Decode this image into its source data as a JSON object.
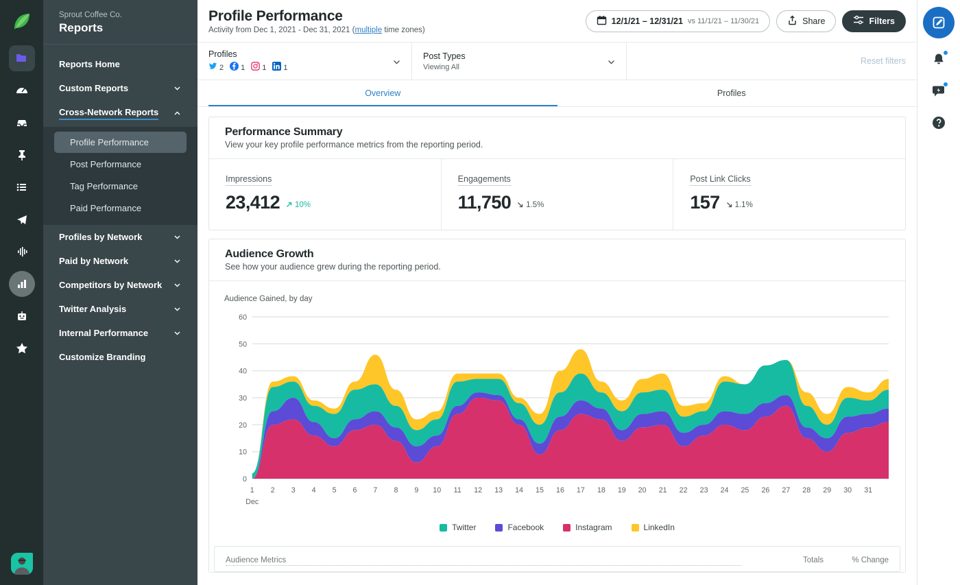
{
  "rail": {
    "logo_icon": "sprout-leaf-logo",
    "items": [
      {
        "name": "folder-icon",
        "state": "boxed"
      },
      {
        "name": "dashboard-gauge-icon",
        "state": "plain"
      },
      {
        "name": "inbox-icon",
        "state": "plain"
      },
      {
        "name": "pin-icon",
        "state": "plain"
      },
      {
        "name": "list-icon",
        "state": "plain"
      },
      {
        "name": "send-paper-plane-icon",
        "state": "plain"
      },
      {
        "name": "audio-waveform-icon",
        "state": "plain"
      },
      {
        "name": "bar-chart-icon",
        "state": "circled"
      },
      {
        "name": "bot-icon",
        "state": "plain"
      },
      {
        "name": "star-icon",
        "state": "plain"
      }
    ],
    "avatar_name": "user-avatar"
  },
  "sidebar": {
    "org": "Sprout Coffee Co.",
    "title": "Reports",
    "items": [
      {
        "label": "Reports Home",
        "chevron": "none"
      },
      {
        "label": "Custom Reports",
        "chevron": "down"
      },
      {
        "label": "Cross-Network Reports",
        "chevron": "up"
      }
    ],
    "sub_items": [
      {
        "label": "Profile Performance",
        "active": true
      },
      {
        "label": "Post Performance",
        "active": false
      },
      {
        "label": "Tag Performance",
        "active": false
      },
      {
        "label": "Paid Performance",
        "active": false
      }
    ],
    "items_bottom": [
      {
        "label": "Profiles by Network",
        "chevron": "down"
      },
      {
        "label": "Paid by Network",
        "chevron": "down"
      },
      {
        "label": "Competitors by Network",
        "chevron": "down"
      },
      {
        "label": "Twitter Analysis",
        "chevron": "down"
      },
      {
        "label": "Internal Performance",
        "chevron": "down"
      },
      {
        "label": "Customize Branding",
        "chevron": "none"
      }
    ]
  },
  "header": {
    "title": "Profile Performance",
    "subtitle_before": "Activity from Dec 1, 2021 - Dec 31, 2021 (",
    "subtitle_link": "multiple",
    "subtitle_after": " time zones)",
    "date_range": "12/1/21 – 12/31/21",
    "date_compare": "vs 11/1/21 – 11/30/21",
    "share_label": "Share",
    "filters_label": "Filters",
    "calendar_icon": "calendar-icon",
    "share_icon": "share-upload-icon",
    "filters_icon": "sliders-icon"
  },
  "filterbar": {
    "profiles_label": "Profiles",
    "networks": [
      {
        "name": "twitter",
        "count": "2",
        "color": "#1da1f2"
      },
      {
        "name": "facebook",
        "count": "1",
        "color": "#1877f2"
      },
      {
        "name": "instagram",
        "count": "1",
        "color": "#e1306c"
      },
      {
        "name": "linkedin",
        "count": "1",
        "color": "#0a66c2"
      }
    ],
    "post_types_label": "Post Types",
    "post_types_value": "Viewing All",
    "reset_label": "Reset filters"
  },
  "tabs": [
    {
      "label": "Overview",
      "active": true
    },
    {
      "label": "Profiles",
      "active": false
    }
  ],
  "performance_summary": {
    "title": "Performance Summary",
    "subtitle": "View your key profile performance metrics from the reporting period.",
    "metrics": [
      {
        "label": "Impressions",
        "value": "23,412",
        "delta": "10%",
        "direction": "up"
      },
      {
        "label": "Engagements",
        "value": "11,750",
        "delta": "1.5%",
        "direction": "down"
      },
      {
        "label": "Post Link Clicks",
        "value": "157",
        "delta": "1.1%",
        "direction": "down"
      }
    ]
  },
  "audience_growth": {
    "title": "Audience Growth",
    "subtitle": "See how your audience grew during the reporting period.",
    "table": {
      "col_metric": "Audience Metrics",
      "col_total": "Totals",
      "col_change": "% Change"
    }
  },
  "chart_data": {
    "type": "area",
    "stacked": true,
    "title": "Audience Gained, by day",
    "xlabel": "Dec",
    "ylabel": "",
    "ylim": [
      0,
      60
    ],
    "yticks": [
      0,
      10,
      20,
      30,
      40,
      50,
      60
    ],
    "grid": true,
    "legend_position": "bottom",
    "x": [
      1,
      2,
      3,
      4,
      5,
      6,
      7,
      8,
      9,
      10,
      11,
      12,
      13,
      14,
      15,
      16,
      17,
      18,
      19,
      20,
      21,
      22,
      23,
      24,
      25,
      26,
      27,
      28,
      29,
      30,
      31
    ],
    "categories": [
      "1",
      "2",
      "3",
      "4",
      "5",
      "6",
      "7",
      "8",
      "9",
      "10",
      "11",
      "12",
      "13",
      "14",
      "15",
      "16",
      "17",
      "18",
      "19",
      "20",
      "21",
      "22",
      "23",
      "24",
      "25",
      "26",
      "27",
      "28",
      "29",
      "30",
      "31"
    ],
    "series": [
      {
        "name": "Instagram",
        "color": "#d6316a",
        "values": [
          0,
          20,
          22,
          16,
          12,
          18,
          20,
          14,
          6,
          12,
          24,
          30,
          29,
          20,
          9,
          18,
          24,
          22,
          14,
          19,
          20,
          12,
          16,
          20,
          18,
          23,
          27,
          15,
          10,
          17,
          19,
          21
        ]
      },
      {
        "name": "Facebook",
        "color": "#5b4bd6",
        "values": [
          0,
          5,
          8,
          5,
          3,
          4,
          5,
          5,
          6,
          4,
          3,
          2,
          2,
          2,
          4,
          5,
          5,
          4,
          4,
          5,
          5,
          5,
          4,
          5,
          6,
          5,
          4,
          4,
          5,
          6,
          5,
          5
        ]
      },
      {
        "name": "Twitter",
        "color": "#17bba2",
        "values": [
          2,
          9,
          6,
          6,
          9,
          11,
          10,
          8,
          6,
          6,
          9,
          5,
          6,
          6,
          7,
          9,
          10,
          6,
          7,
          8,
          8,
          6,
          5,
          11,
          11,
          14,
          13,
          8,
          5,
          7,
          5,
          7
        ]
      },
      {
        "name": "LinkedIn",
        "color": "#ffc629",
        "values": [
          0,
          2,
          2,
          2,
          2,
          3,
          11,
          6,
          4,
          3,
          3,
          2,
          2,
          2,
          4,
          8,
          9,
          4,
          4,
          5,
          6,
          4,
          3,
          2,
          0,
          0,
          0,
          5,
          4,
          4,
          3,
          4
        ]
      }
    ],
    "legend": [
      "Twitter",
      "Facebook",
      "Instagram",
      "LinkedIn"
    ]
  }
}
